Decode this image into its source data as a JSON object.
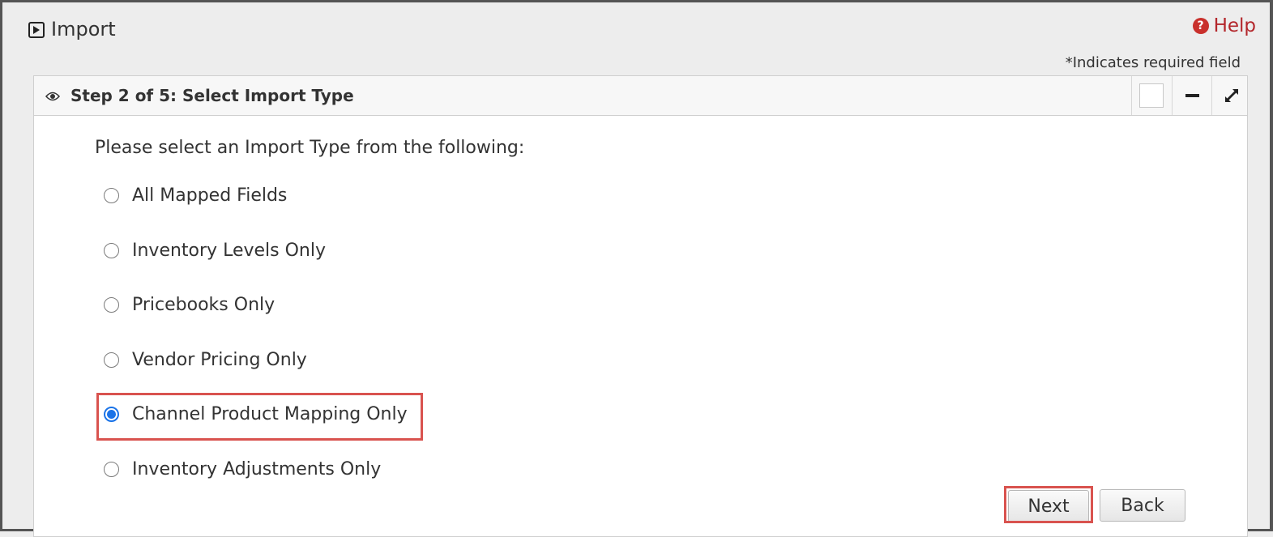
{
  "header": {
    "title": "Import",
    "title_icon": "play-square-icon",
    "help_label": "Help",
    "help_icon": "question-circle-icon",
    "required_note": "*Indicates required field"
  },
  "panel": {
    "title": "Step 2 of 5: Select Import Type",
    "title_icon": "eye-icon",
    "tools": [
      "checkbox",
      "minimize-icon",
      "expand-icon"
    ]
  },
  "form": {
    "prompt": "Please select an Import Type from the following:",
    "options": [
      {
        "label": "All Mapped Fields",
        "selected": false
      },
      {
        "label": "Inventory Levels Only",
        "selected": false
      },
      {
        "label": "Pricebooks Only",
        "selected": false
      },
      {
        "label": "Vendor Pricing Only",
        "selected": false
      },
      {
        "label": "Channel Product Mapping Only",
        "selected": true
      },
      {
        "label": "Inventory Adjustments Only",
        "selected": false
      }
    ],
    "selected_value": "Channel Product Mapping Only"
  },
  "buttons": {
    "next": "Next",
    "back": "Back"
  },
  "colors": {
    "highlight": "#d9534f",
    "radio_selected": "#1a73e8",
    "help": "#b3262b"
  }
}
